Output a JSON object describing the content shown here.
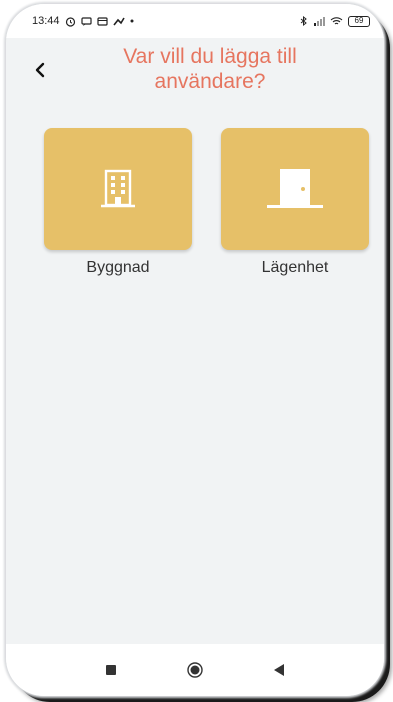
{
  "status_bar": {
    "time": "13:44",
    "battery": "69"
  },
  "header": {
    "title": "Var vill du lägga till användare?"
  },
  "options": [
    {
      "label": "Byggnad",
      "icon": "building-icon"
    },
    {
      "label": "Lägenhet",
      "icon": "door-icon"
    }
  ],
  "colors": {
    "title": "#e6755f",
    "tile": "#e6c068",
    "background": "#f1f3f4"
  },
  "nav": {
    "icons": [
      "square-recent-icon",
      "circle-home-icon",
      "triangle-back-icon"
    ]
  }
}
